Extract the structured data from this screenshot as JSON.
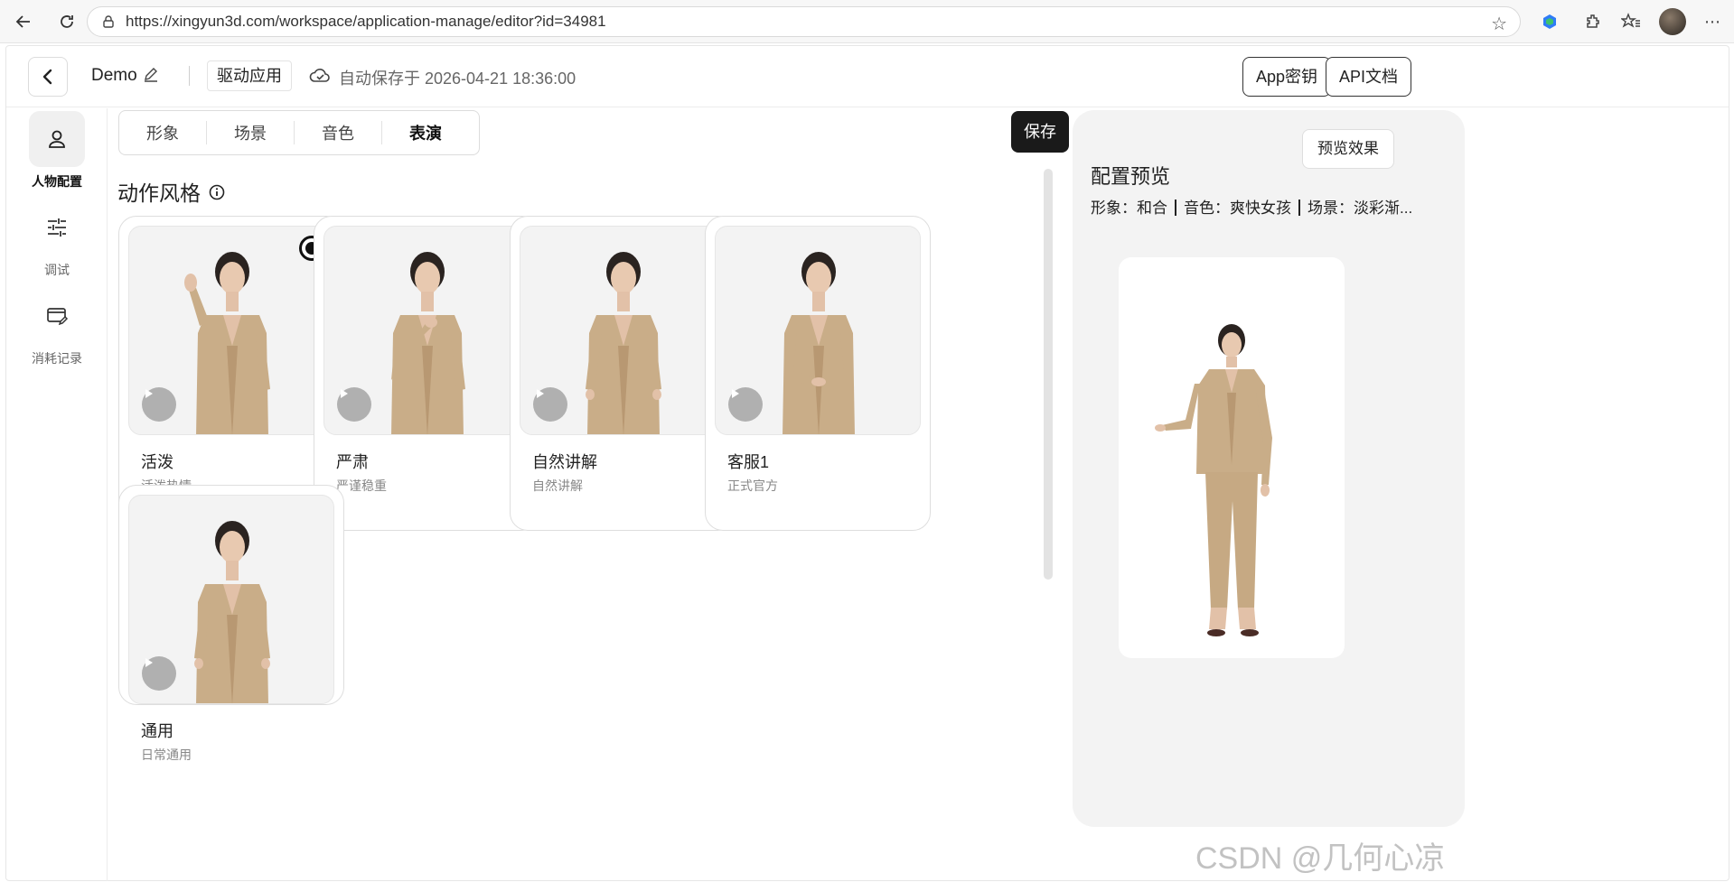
{
  "browser": {
    "url": "https://xingyun3d.com/workspace/application-manage/editor?id=34981"
  },
  "header": {
    "back_label": "",
    "app_name": "Demo",
    "drive_tag": "驱动应用",
    "autosave": "自动保存于 2026-04-21 18:36:00",
    "app_key_button": "App密钥",
    "api_docs_button": "API文档"
  },
  "sidebar": {
    "items": [
      {
        "label": "人物配置",
        "icon": "person-icon",
        "active": true
      },
      {
        "label": "调试",
        "icon": "sliders-icon",
        "active": false
      },
      {
        "label": "消耗记录",
        "icon": "card-edit-icon",
        "active": false
      }
    ]
  },
  "tabs": [
    {
      "label": "形象",
      "active": false
    },
    {
      "label": "场景",
      "active": false
    },
    {
      "label": "音色",
      "active": false
    },
    {
      "label": "表演",
      "active": true
    }
  ],
  "save_button": "保存",
  "section": {
    "title": "动作风格"
  },
  "styles": [
    {
      "name": "活泼",
      "desc": "活泼热情",
      "selected": true,
      "pose": "wave"
    },
    {
      "name": "严肃",
      "desc": "严谨稳重",
      "selected": false,
      "pose": "hand-chest"
    },
    {
      "name": "自然讲解",
      "desc": "自然讲解",
      "selected": false,
      "pose": "relaxed"
    },
    {
      "name": "客服1",
      "desc": "正式官方",
      "selected": false,
      "pose": "clasped"
    },
    {
      "name": "通用",
      "desc": "日常通用",
      "selected": false,
      "pose": "relaxed"
    }
  ],
  "preview": {
    "button": "预览效果",
    "title": "配置预览",
    "info_parts": [
      "形象：和合",
      "音色：爽快女孩",
      "场景：淡彩渐..."
    ]
  },
  "watermark": "CSDN @几何心凉",
  "colors": {
    "accent": "#1a1a1a",
    "suit": "#c9ad88",
    "panel_bg": "#f3f3f3"
  }
}
